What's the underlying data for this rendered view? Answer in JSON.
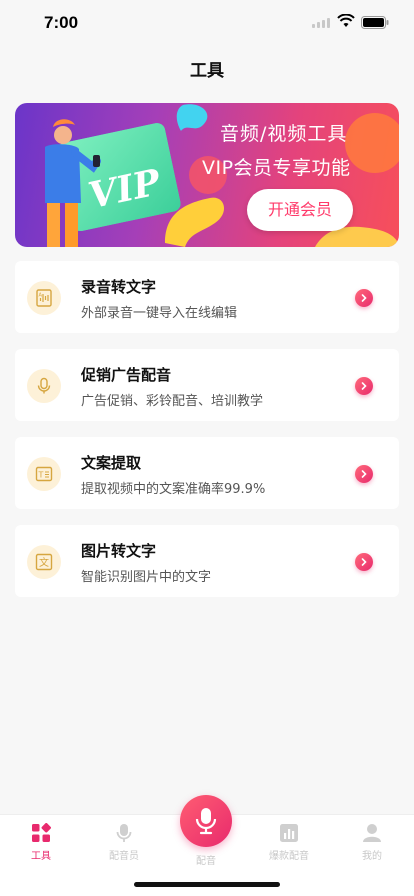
{
  "status_bar": {
    "time": "7:00"
  },
  "header": {
    "title": "工具"
  },
  "banner": {
    "title": "音频/视频工具",
    "subtitle": "VIP会员专享功能",
    "button_label": "开通会员",
    "card_text": "VIP"
  },
  "tools": [
    {
      "title": "录音转文字",
      "desc": "外部录音一键导入在线编辑",
      "icon": "audio-file-icon"
    },
    {
      "title": "促销广告配音",
      "desc": "广告促销、彩铃配音、培训教学",
      "icon": "microphone-icon"
    },
    {
      "title": "文案提取",
      "desc": "提取视频中的文案准确率99.9%",
      "icon": "text-extract-icon"
    },
    {
      "title": "图片转文字",
      "desc": "智能识别图片中的文字",
      "icon": "image-text-icon"
    }
  ],
  "tab_bar": {
    "items": [
      {
        "label": "工具",
        "icon": "tools-grid-icon",
        "active": true
      },
      {
        "label": "配音员",
        "icon": "microphone-icon",
        "active": false
      },
      {
        "label": "配音",
        "icon": "microphone-icon",
        "active": false
      },
      {
        "label": "爆款配音",
        "icon": "bar-chart-icon",
        "active": false
      },
      {
        "label": "我的",
        "icon": "user-icon",
        "active": false
      }
    ]
  },
  "colors": {
    "accent": "#e82a6d",
    "banner_gradient_start": "#6b35c9",
    "banner_gradient_end": "#f74f5a",
    "icon_bg": "#fdf1d8",
    "icon_fg": "#d6a640"
  }
}
